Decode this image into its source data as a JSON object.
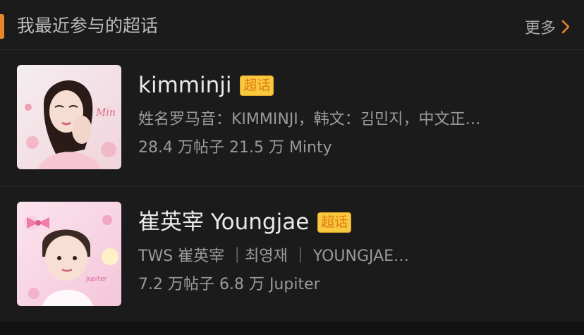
{
  "header": {
    "title": "我最近参与的超话",
    "more_label": "更多"
  },
  "items": [
    {
      "name": "kimminji",
      "badge": "超话",
      "desc": "姓名罗马音：KIMMINJI，韩文：김민지，中文正…",
      "stats": "28.4 万帖子 21.5 万 Minty",
      "thumb_icon": "portrait-photo"
    },
    {
      "name": "崔英宰 Youngjae",
      "badge": "超话",
      "desc": "TWS 崔英宰 ｜최영재 ｜ YOUNGJAE…",
      "stats": "7.2 万帖子 6.8 万 Jupiter",
      "thumb_icon": "portrait-photo"
    }
  ],
  "colors": {
    "accent": "#e8862a",
    "badge_bg": "#f8c93e",
    "badge_text": "#e07a14",
    "panel_bg": "#1b1b1b"
  }
}
